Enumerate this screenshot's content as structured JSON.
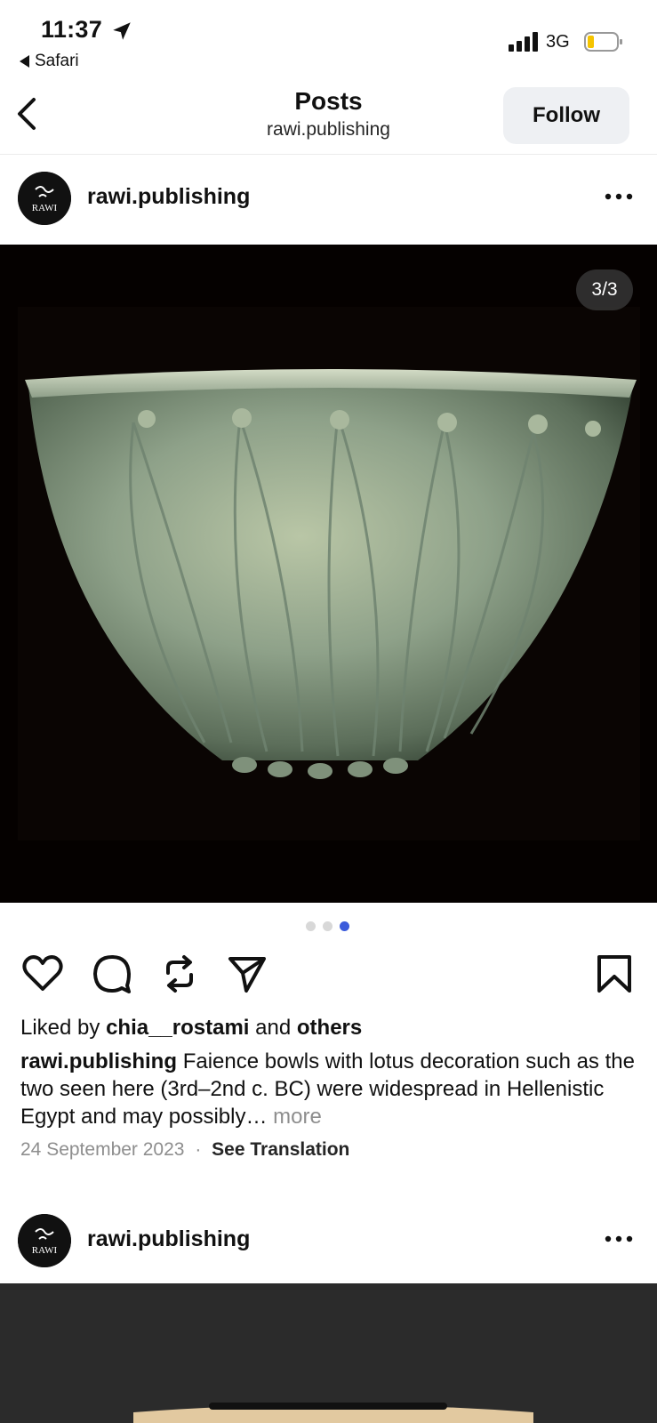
{
  "status_bar": {
    "time": "11:37",
    "back_app": "Safari",
    "network": "3G"
  },
  "nav": {
    "title": "Posts",
    "subtitle": "rawi.publishing",
    "follow_label": "Follow"
  },
  "posts": [
    {
      "username": "rawi.publishing",
      "counter": "3/3",
      "carousel": {
        "count": 3,
        "active_index": 2
      },
      "likes": {
        "prefix": "Liked by",
        "user": "chia__rostami",
        "and": "and",
        "others": "others"
      },
      "caption": {
        "user": "rawi.publishing",
        "text": "Faience bowls with lotus decoration such as the two seen here (3rd–2nd c. BC) were widespread in Hellenistic Egypt and may possibly…",
        "more": "more"
      },
      "date": "24 September 2023",
      "separator": "·",
      "see_translation": "See Translation"
    },
    {
      "username": "rawi.publishing"
    }
  ],
  "avatar_text": "RAWI",
  "colors": {
    "accent_dot": "#3b5bdb",
    "follow_bg": "#eef0f3",
    "image_bg": "#050100"
  }
}
